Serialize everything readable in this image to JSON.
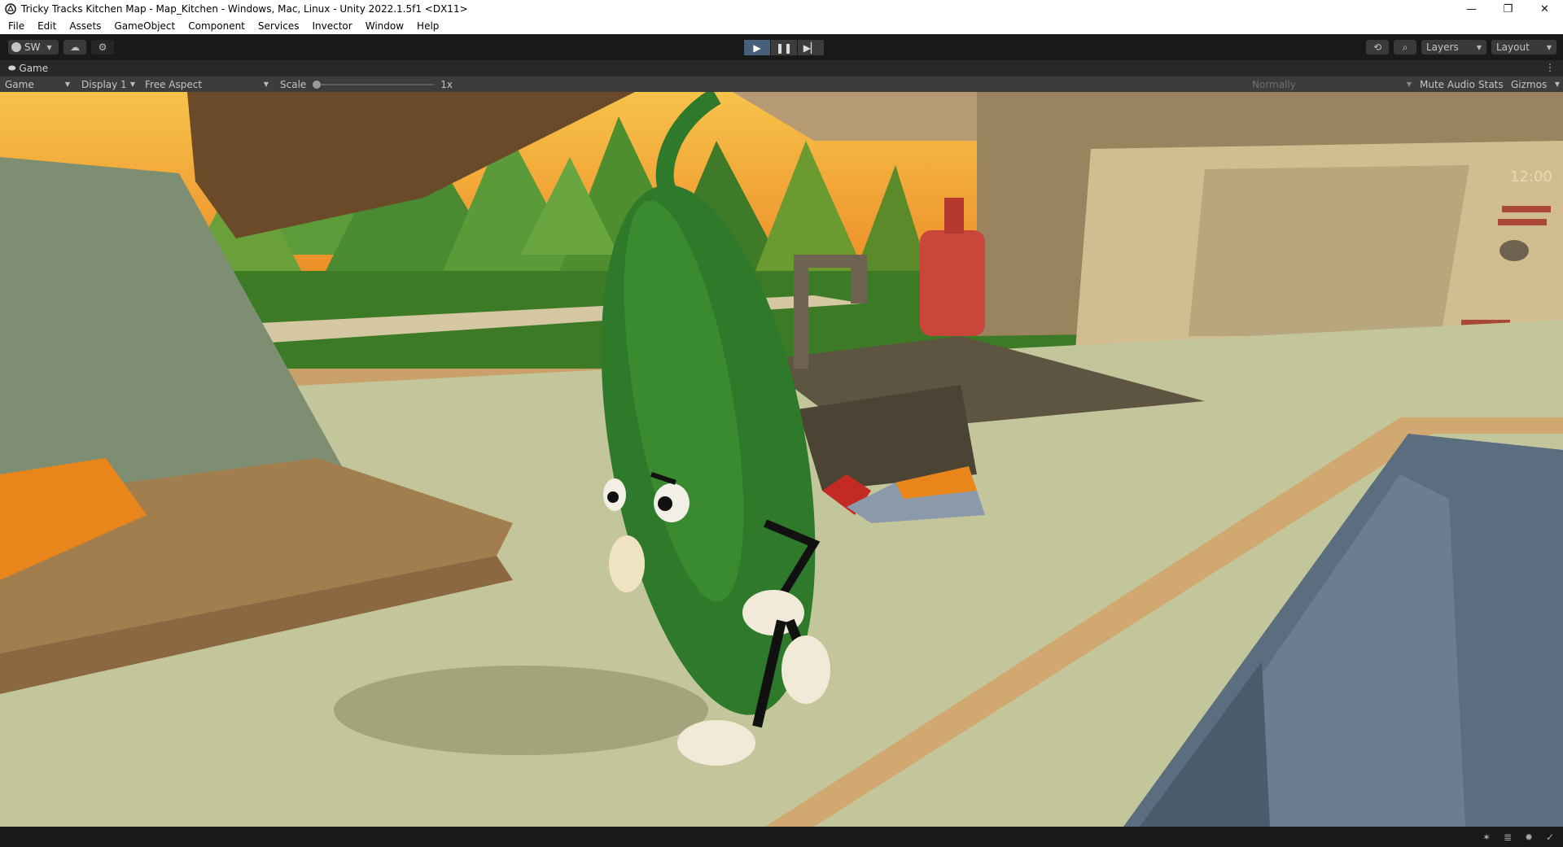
{
  "window": {
    "title": "Tricky Tracks Kitchen Map - Map_Kitchen - Windows, Mac, Linux - Unity 2022.1.5f1 <DX11>",
    "minimize_icon": "minimize-icon",
    "maximize_icon": "restore-icon",
    "close_icon": "close-icon"
  },
  "menu": [
    "File",
    "Edit",
    "Assets",
    "GameObject",
    "Component",
    "Services",
    "Invector",
    "Window",
    "Help"
  ],
  "toolbar": {
    "account_label": "SW",
    "play_state": "playing",
    "layers_label": "Layers",
    "layout_label": "Layout"
  },
  "game_tab": {
    "label": "Game"
  },
  "game_view": {
    "mode": "Game",
    "display": "Display 1",
    "aspect": "Free Aspect",
    "scale_label": "Scale",
    "scale_value": "1x",
    "normally": "Normally",
    "mute_audio": "Mute Audio",
    "stats": "Stats",
    "gizmos": "Gizmos"
  },
  "scene": {
    "microwave_clock": "12:00",
    "sky_color": "#f08c1a",
    "tree_color": "#4e8a2e",
    "counter_color": "#c3c69a",
    "cucumber_color": "#2f7a2a",
    "bottle_color": "#c8463a",
    "fridge_color": "#5a6e80"
  }
}
